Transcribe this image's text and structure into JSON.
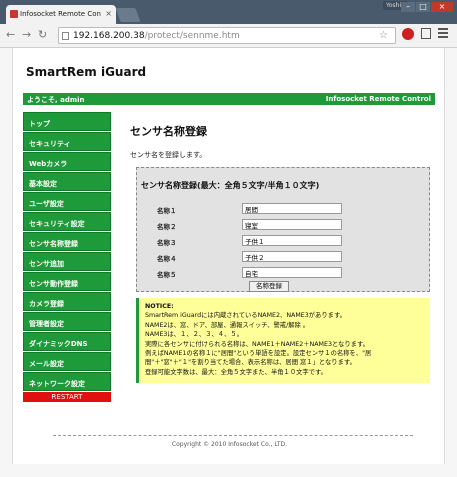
{
  "browser": {
    "tab_title": "Infosocket Remote Con",
    "profile_name": "Yoshie",
    "url_host": "192.168.200.38",
    "url_path": "/protect/sennme.htm",
    "back_icon": "←",
    "forward_icon": "→",
    "reload_icon": "↻",
    "star_icon": "☆",
    "tab_close": "×",
    "win_min": "–",
    "win_max": "□",
    "win_close": "×"
  },
  "site": {
    "title": "SmartRem iGuard",
    "welcome": "ようこそ, admin",
    "product": "Infosocket Remote Control",
    "accent_color": "#1e9a3a"
  },
  "sidebar": {
    "items": [
      {
        "label": "トップ"
      },
      {
        "label": "セキュリティ"
      },
      {
        "label": "Webカメラ"
      },
      {
        "label": "基本設定"
      },
      {
        "label": "ユーザ設定"
      },
      {
        "label": "セキュリティ設定"
      },
      {
        "label": "センサ名称登録"
      },
      {
        "label": "センサ追加"
      },
      {
        "label": "センサ動作登録"
      },
      {
        "label": "カメラ登録"
      },
      {
        "label": "管理者設定"
      },
      {
        "label": "ダイナミックDNS"
      },
      {
        "label": "メール設定"
      },
      {
        "label": "ネットワーク設定"
      }
    ],
    "restart": "RESTART"
  },
  "main": {
    "title": "センサ名称登録",
    "description": "センサ名を登録します。",
    "form_title": "センサ名称登録(最大：全角５文字/半角１０文字)",
    "fields": [
      {
        "label": "名称１",
        "value": "居間"
      },
      {
        "label": "名称２",
        "value": "寝室"
      },
      {
        "label": "名称３",
        "value": "子供１"
      },
      {
        "label": "名称４",
        "value": "子供２"
      },
      {
        "label": "名称５",
        "value": "自宅"
      }
    ],
    "register_button": "名称登録"
  },
  "notice": {
    "title": "NOTICE:",
    "lines": [
      "SmartRem iGuardには内蔵されているNAME2、NAME3があります。",
      "NAME2は、窓、ドア、部屋、通報スイッチ、警戒/解除 。",
      "NAME3は、１、２、３、４、５。",
      "実際に各センサに付けられる名称は、NAME1＋NAME2＋NAME3となります。",
      "例えばNAME1の名称１に\"居間\"という単語を設定。設定センサ１の名称を、\"居",
      "間\"＋\"窓\"＋\"１\"を割り当てた場合、表示名称は、居間 窓１」となります。",
      "登録可能文字数は、最大：全角５文字また、半角１０文字です。"
    ]
  },
  "footer": {
    "copyright": "Copyright © 2010 Infosocket Co., LTD."
  }
}
